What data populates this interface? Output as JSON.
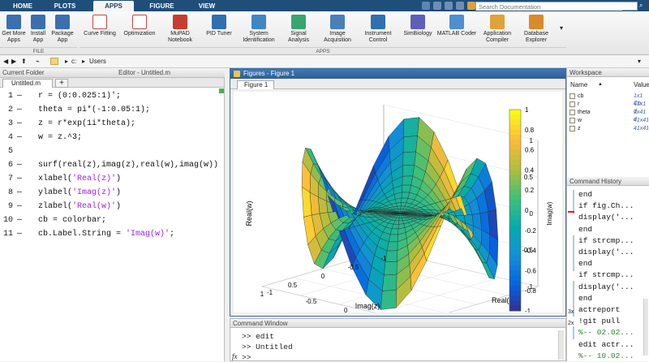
{
  "tabs": [
    "HOME",
    "PLOTS",
    "APPS",
    "FIGURE",
    "VIEW"
  ],
  "search_placeholder": "Search Documentation",
  "ribbon": {
    "file_buttons": [
      {
        "label": "Get More Apps",
        "icon": "get-apps-icon"
      },
      {
        "label": "Install App",
        "icon": "install-app-icon"
      },
      {
        "label": "Package App",
        "icon": "package-app-icon"
      }
    ],
    "app_buttons": [
      {
        "label": "Curve Fitting",
        "icon": "curve-fitting-icon"
      },
      {
        "label": "Optimization",
        "icon": "optimization-icon"
      },
      {
        "label": "MuPAD Notebook",
        "icon": "mupad-icon"
      },
      {
        "label": "PID Tuner",
        "icon": "pid-tuner-icon"
      },
      {
        "label": "System Identification",
        "icon": "system-id-icon"
      },
      {
        "label": "Signal Analysis",
        "icon": "signal-analysis-icon"
      },
      {
        "label": "Image Acquisition",
        "icon": "image-acquisition-icon"
      },
      {
        "label": "Instrument Control",
        "icon": "instrument-control-icon"
      },
      {
        "label": "SimBiology",
        "icon": "simbiology-icon"
      },
      {
        "label": "MATLAB Coder",
        "icon": "matlab-coder-icon"
      },
      {
        "label": "Application Compiler",
        "icon": "app-compiler-icon"
      },
      {
        "label": "Database Explorer",
        "icon": "database-explorer-icon"
      }
    ],
    "section_file": "FILE",
    "section_apps": "APPS"
  },
  "path": {
    "drive": "c:",
    "folder": "Users"
  },
  "panels": {
    "current_folder": "Current Folder",
    "editor": "Editor - Untitled.m",
    "figures": "Figures - Figure 1",
    "command_window": "Command Window",
    "workspace": "Workspace",
    "command_history": "Command History"
  },
  "editor": {
    "tab": "Untitled.m",
    "plus": "+",
    "lines": [
      {
        "n": "1",
        "dash": "—",
        "code": "r = (0:0.025:1)';",
        "str": ""
      },
      {
        "n": "2",
        "dash": "—",
        "code": "theta = pi*(-1:0.05:1);",
        "str": ""
      },
      {
        "n": "3",
        "dash": "—",
        "code": "z = r*exp(1i*theta);",
        "str": ""
      },
      {
        "n": "4",
        "dash": "—",
        "code": "w = z.^3;",
        "str": ""
      },
      {
        "n": "5",
        "dash": "",
        "code": "",
        "str": ""
      },
      {
        "n": "6",
        "dash": "—",
        "code": "surf(real(z),imag(z),real(w),imag(w))",
        "str": ""
      },
      {
        "n": "7",
        "dash": "—",
        "code": "xlabel(",
        "str": "'Real(z)'",
        "tail": ")"
      },
      {
        "n": "8",
        "dash": "—",
        "code": "ylabel(",
        "str": "'Imag(z)'",
        "tail": ")"
      },
      {
        "n": "9",
        "dash": "—",
        "code": "zlabel(",
        "str": "'Real(w)'",
        "tail": ")"
      },
      {
        "n": "10",
        "dash": "—",
        "code": "cb = colorbar;",
        "str": ""
      },
      {
        "n": "11",
        "dash": "—",
        "code": "cb.Label.String = ",
        "str": "'Imag(w)'",
        "tail": ";"
      }
    ]
  },
  "figure": {
    "tab": "Figure 1",
    "colorbar_label": "Imag(w)",
    "colorbar_ticks": [
      "1",
      "0.8",
      "0.6",
      "0.4",
      "0.2",
      "0",
      "-0.2",
      "-0.4",
      "-0.6",
      "-0.8",
      "-1"
    ],
    "xlabel": "Imag(z)",
    "ylabel": "Real(z)",
    "zlabel": "Real(w)",
    "x_ticks": [
      "1",
      "0.5",
      "0",
      "-0.5",
      "-1"
    ],
    "y_ticks": [
      "-1",
      "-0.5",
      "0",
      "0.5",
      "1"
    ],
    "z_ticks": [
      "1",
      "0.5",
      "0",
      "-0.5",
      "-1"
    ]
  },
  "command_window": {
    "lines": [
      ">> edit",
      ">> Untitled",
      ">>"
    ],
    "fx": "fx"
  },
  "workspace": {
    "col_name": "Name",
    "col_value": "Value",
    "vars": [
      {
        "name": "cb",
        "value": "1x1 Co"
      },
      {
        "name": "r",
        "value": "41x1 d"
      },
      {
        "name": "theta",
        "value": "1x41 d"
      },
      {
        "name": "w",
        "value": "41x41"
      },
      {
        "name": "z",
        "value": "41x41"
      }
    ]
  },
  "history": {
    "lines": [
      {
        "text": "end",
        "cls": ""
      },
      {
        "text": "if fig.Ch...",
        "cls": ""
      },
      {
        "text": "display('...",
        "cls": ""
      },
      {
        "text": "end",
        "cls": ""
      },
      {
        "text": "if strcmp...",
        "cls": ""
      },
      {
        "text": "display('...",
        "cls": ""
      },
      {
        "text": "end",
        "cls": ""
      },
      {
        "text": "if strcmp...",
        "cls": ""
      },
      {
        "text": "display('...",
        "cls": ""
      },
      {
        "text": "end",
        "cls": ""
      },
      {
        "text": "actreport",
        "cls": ""
      },
      {
        "text": "!git pull",
        "cls": ""
      },
      {
        "text": "%-- 02.02...",
        "cls": "hgreen"
      },
      {
        "text": "edit actr...",
        "cls": ""
      },
      {
        "text": "%-- 10.02...",
        "cls": "hgreen"
      }
    ],
    "badges": [
      "3x",
      "2x"
    ]
  }
}
